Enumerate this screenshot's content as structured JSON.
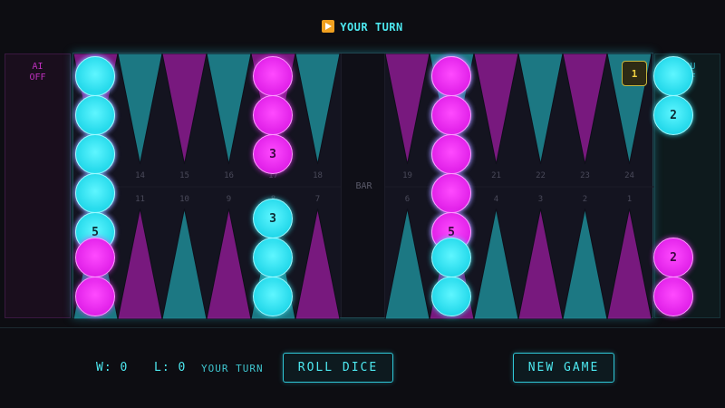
{
  "header": {
    "turn_banner": "YOUR TURN",
    "turn_icon": "play-icon"
  },
  "trays": {
    "ai_label_line1": "AI",
    "ai_label_line2": "OFF",
    "you_label_line1": "YOU",
    "you_label_line2": "OFF"
  },
  "board": {
    "bar_label": "BAR",
    "top_point_numbers": [
      "13",
      "14",
      "15",
      "16",
      "17",
      "18",
      "19",
      "20",
      "21",
      "22",
      "23",
      "24"
    ],
    "bottom_point_numbers": [
      "12",
      "11",
      "10",
      "9",
      "8",
      "7",
      "6",
      "5",
      "4",
      "3",
      "2",
      "1"
    ],
    "doubling_cube_value": "1",
    "colors": {
      "cyan": "#22d8ea",
      "magenta": "#e020e8"
    },
    "stacks": [
      {
        "row": "top",
        "col": 0,
        "checkers": [
          {
            "color": "magenta"
          },
          {
            "color": "magenta"
          },
          {
            "color": "magenta"
          },
          {
            "color": "magenta"
          },
          {
            "color": "magenta",
            "label": ""
          }
        ]
      },
      {
        "row": "top",
        "col": 0,
        "overlay": true,
        "checkers": [
          {
            "color": "cyan"
          },
          {
            "color": "cyan"
          },
          {
            "color": "cyan"
          },
          {
            "color": "cyan"
          },
          {
            "color": "cyan",
            "label": "5"
          }
        ]
      },
      {
        "row": "top",
        "col": 4,
        "checkers": [
          {
            "color": "magenta"
          },
          {
            "color": "magenta"
          },
          {
            "color": "magenta",
            "label": "3"
          }
        ]
      },
      {
        "row": "top",
        "col": 7,
        "checkers": [
          {
            "color": "cyan"
          },
          {
            "color": "cyan"
          },
          {
            "color": "cyan"
          },
          {
            "color": "cyan"
          },
          {
            "color": "cyan"
          }
        ]
      },
      {
        "row": "top",
        "col": 7,
        "overlay": true,
        "checkers": [
          {
            "color": "magenta"
          },
          {
            "color": "magenta"
          },
          {
            "color": "magenta"
          },
          {
            "color": "magenta"
          },
          {
            "color": "magenta",
            "label": "5"
          }
        ]
      },
      {
        "row": "top",
        "col": 12,
        "checkers": [
          {
            "color": "cyan"
          },
          {
            "color": "cyan",
            "label": "2"
          }
        ]
      },
      {
        "row": "bottom",
        "col": 0,
        "checkers": [
          {
            "color": "magenta"
          },
          {
            "color": "magenta"
          }
        ]
      },
      {
        "row": "bottom",
        "col": 4,
        "checkers": [
          {
            "color": "cyan"
          },
          {
            "color": "cyan"
          },
          {
            "color": "cyan",
            "label": "3"
          }
        ]
      },
      {
        "row": "bottom",
        "col": 7,
        "checkers": [
          {
            "color": "cyan"
          },
          {
            "color": "cyan"
          }
        ]
      },
      {
        "row": "bottom",
        "col": 12,
        "checkers": [
          {
            "color": "magenta"
          },
          {
            "color": "magenta",
            "label": "2"
          }
        ]
      }
    ]
  },
  "footer": {
    "wins_label": "W: 0",
    "losses_label": "L: 0",
    "turn_text": "YOUR TURN",
    "roll_dice_label": "ROLL DICE",
    "new_game_label": "NEW GAME"
  }
}
